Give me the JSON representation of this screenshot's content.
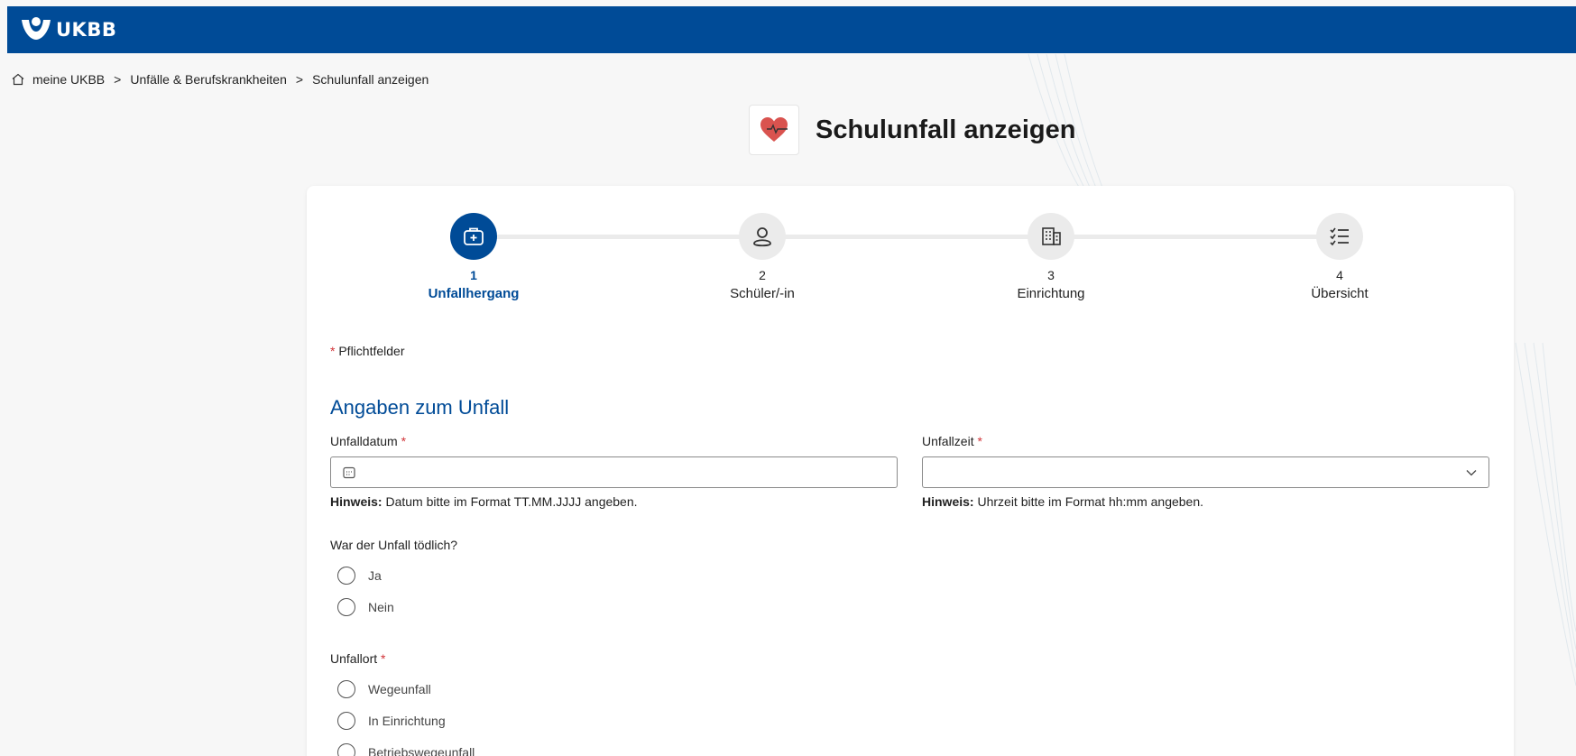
{
  "header": {
    "logo_text": "UKBB"
  },
  "breadcrumb": {
    "items": [
      "meine UKBB",
      "Unfälle & Berufskrankheiten",
      "Schulunfall anzeigen"
    ],
    "separator": ">"
  },
  "page": {
    "title": "Schulunfall anzeigen"
  },
  "stepper": {
    "steps": [
      {
        "number": "1",
        "label": "Unfallhergang",
        "icon": "medical-case-icon",
        "active": true
      },
      {
        "number": "2",
        "label": "Schüler/-in",
        "icon": "person-icon",
        "active": false
      },
      {
        "number": "3",
        "label": "Einrichtung",
        "icon": "building-icon",
        "active": false
      },
      {
        "number": "4",
        "label": "Übersicht",
        "icon": "checklist-icon",
        "active": false
      }
    ]
  },
  "form": {
    "required_marker": "*",
    "required_note": "Pflichtfelder",
    "section_title": "Angaben zum Unfall",
    "date_field": {
      "label": "Unfalldatum",
      "value": "",
      "hint_bold": "Hinweis:",
      "hint_text": "Datum bitte im Format TT.MM.JJJJ angeben."
    },
    "time_field": {
      "label": "Unfallzeit",
      "value": "",
      "hint_bold": "Hinweis:",
      "hint_text": "Uhrzeit bitte im Format hh:mm angeben."
    },
    "fatal_question": {
      "label": "War der Unfall tödlich?",
      "options": [
        "Ja",
        "Nein"
      ]
    },
    "location_question": {
      "label": "Unfallort",
      "options": [
        "Wegeunfall",
        "In Einrichtung",
        "Betriebswegeunfall"
      ]
    }
  },
  "colors": {
    "brand": "#004b97",
    "required": "#d13438"
  }
}
